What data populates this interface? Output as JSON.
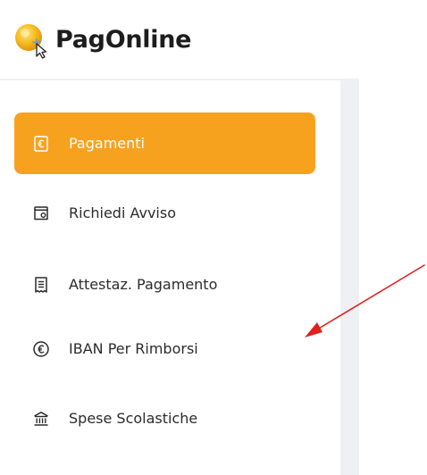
{
  "brand": {
    "name": "PagOnline"
  },
  "sidebar": {
    "items": [
      {
        "label": "Pagamenti",
        "icon": "euro-receipt-icon",
        "active": true
      },
      {
        "label": "Richiedi Avviso",
        "icon": "request-notice-icon",
        "active": false
      },
      {
        "label": "Attestaz. Pagamento",
        "icon": "receipt-icon",
        "active": false
      },
      {
        "label": "IBAN Per Rimborsi",
        "icon": "euro-circle-icon",
        "active": false
      },
      {
        "label": "Spese Scolastiche",
        "icon": "school-building-icon",
        "active": false
      }
    ]
  },
  "colors": {
    "accent": "#f7a21f",
    "text": "#2b2b2b",
    "background_panel": "#eef0f4",
    "annotation_arrow": "#e0201e"
  },
  "annotation": {
    "type": "arrow",
    "color": "#e0201e",
    "points_to": "IBAN Per Rimborsi"
  }
}
